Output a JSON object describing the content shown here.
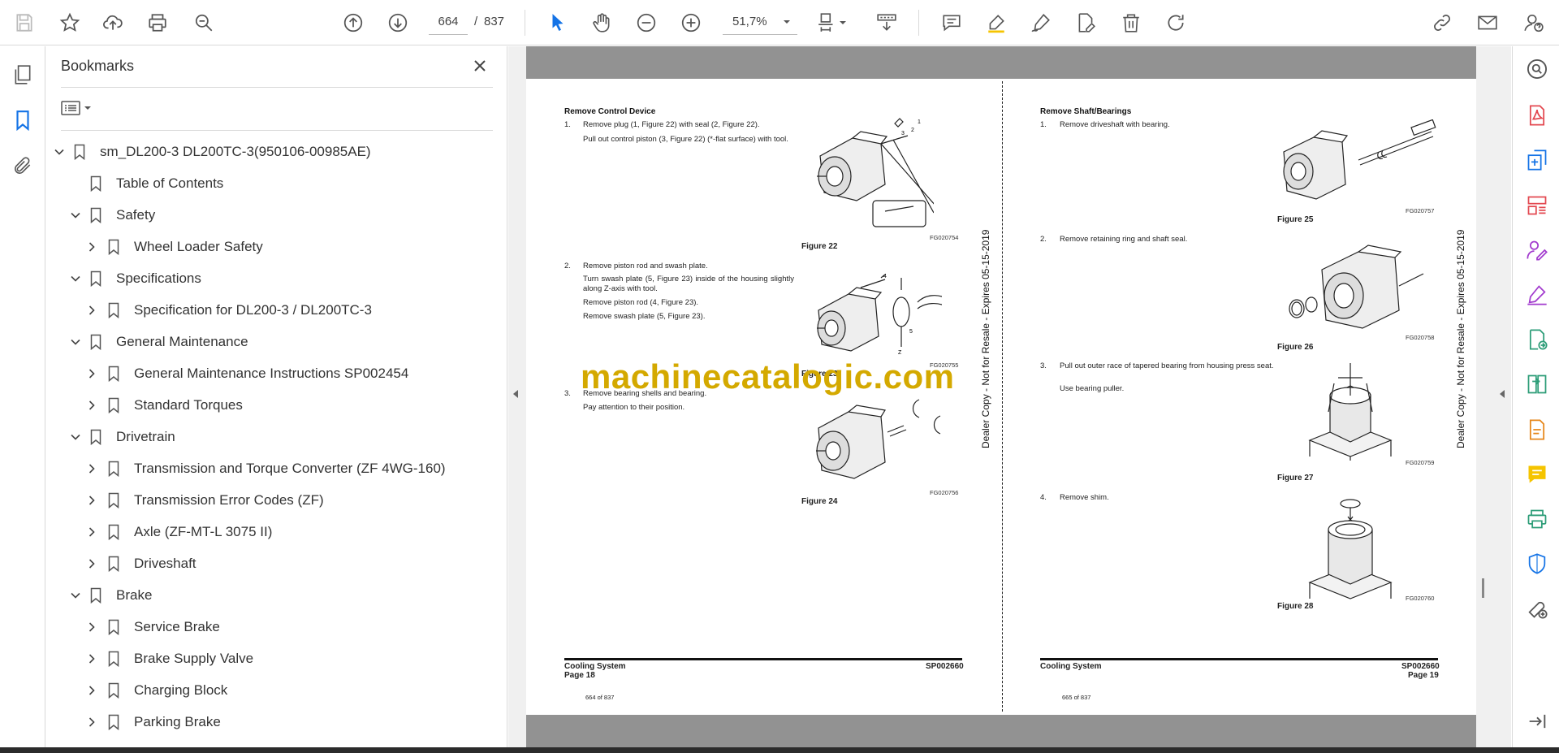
{
  "toolbar": {
    "page_current": "664",
    "page_separator": "/",
    "page_total": "837",
    "zoom": "51,7%"
  },
  "bookmarks": {
    "title": "Bookmarks",
    "items": [
      {
        "label": "sm_DL200-3 DL200TC-3(950106-00985AE)",
        "level": 0,
        "state": "expanded"
      },
      {
        "label": "Table of Contents",
        "level": 1,
        "state": "leaf"
      },
      {
        "label": "Safety",
        "level": 1,
        "state": "expanded"
      },
      {
        "label": "Wheel Loader Safety",
        "level": 2,
        "state": "collapsed"
      },
      {
        "label": "Specifications",
        "level": 1,
        "state": "expanded"
      },
      {
        "label": "Specification for DL200-3 / DL200TC-3",
        "level": 2,
        "state": "collapsed"
      },
      {
        "label": "General Maintenance",
        "level": 1,
        "state": "expanded"
      },
      {
        "label": "General Maintenance Instructions SP002454",
        "level": 2,
        "state": "collapsed"
      },
      {
        "label": "Standard Torques",
        "level": 2,
        "state": "collapsed"
      },
      {
        "label": "Drivetrain",
        "level": 1,
        "state": "expanded"
      },
      {
        "label": "Transmission and Torque Converter (ZF 4WG-160)",
        "level": 2,
        "state": "collapsed"
      },
      {
        "label": "Transmission Error Codes (ZF)",
        "level": 2,
        "state": "collapsed"
      },
      {
        "label": "Axle (ZF-MT-L 3075 II)",
        "level": 2,
        "state": "collapsed"
      },
      {
        "label": "Driveshaft",
        "level": 2,
        "state": "collapsed"
      },
      {
        "label": "Brake",
        "level": 1,
        "state": "expanded"
      },
      {
        "label": "Service Brake",
        "level": 2,
        "state": "collapsed"
      },
      {
        "label": "Brake Supply Valve",
        "level": 2,
        "state": "collapsed"
      },
      {
        "label": "Charging Block",
        "level": 2,
        "state": "collapsed"
      },
      {
        "label": "Parking Brake",
        "level": 2,
        "state": "collapsed"
      }
    ]
  },
  "document": {
    "watermark": "machinecatalogic.com",
    "dealer_note": "Dealer Copy - Not for Resale - Expires 05-15-2019",
    "left_page": {
      "heading": "Remove Control Device",
      "step1_num": "1.",
      "step1_a": "Remove plug (1, Figure 22) with seal (2, Figure 22).",
      "step1_b": "Pull out control piston (3, Figure 22) (*-flat surface) with tool.",
      "fig22_caption": "Figure 22",
      "fig22_code": "FG020754",
      "step2_num": "2.",
      "step2_a": "Remove piston rod and swash plate.",
      "step2_b": "Turn swash plate (5, Figure 23) inside of the housing slightly along Z-axis with tool.",
      "step2_c": "Remove piston rod (4, Figure 23).",
      "step2_d": "Remove swash plate (5, Figure 23).",
      "fig23_caption": "Figure 23",
      "fig23_code": "FG020755",
      "step3_num": "3.",
      "step3_a": "Remove bearing shells and bearing.",
      "step3_b": "Pay attention to their position.",
      "fig24_caption": "Figure 24",
      "fig24_code": "FG020756",
      "footer_title": "Cooling System",
      "footer_page": "Page 18",
      "footer_code": "SP002660",
      "footer_small": "664 of 837"
    },
    "right_page": {
      "heading": "Remove Shaft/Bearings",
      "step1_num": "1.",
      "step1_a": "Remove driveshaft with bearing.",
      "fig25_caption": "Figure 25",
      "fig25_code": "FG020757",
      "step2_num": "2.",
      "step2_a": "Remove retaining ring and shaft seal.",
      "fig26_caption": "Figure 26",
      "fig26_code": "FG020758",
      "step3_num": "3.",
      "step3_a": "Pull out outer race of tapered bearing from housing press seat.",
      "step3_b": "Use bearing puller.",
      "fig27_caption": "Figure 27",
      "fig27_code": "FG020759",
      "step4_num": "4.",
      "step4_a": "Remove shim.",
      "fig28_caption": "Figure 28",
      "fig28_code": "FG020760",
      "footer_title": "Cooling System",
      "footer_page": "Page 19",
      "footer_code": "SP002660",
      "footer_small": "665 of 837"
    }
  },
  "colors": {
    "accent_blue": "#1473e6",
    "watermark": "#d4a900",
    "page_gray": "#929292"
  }
}
